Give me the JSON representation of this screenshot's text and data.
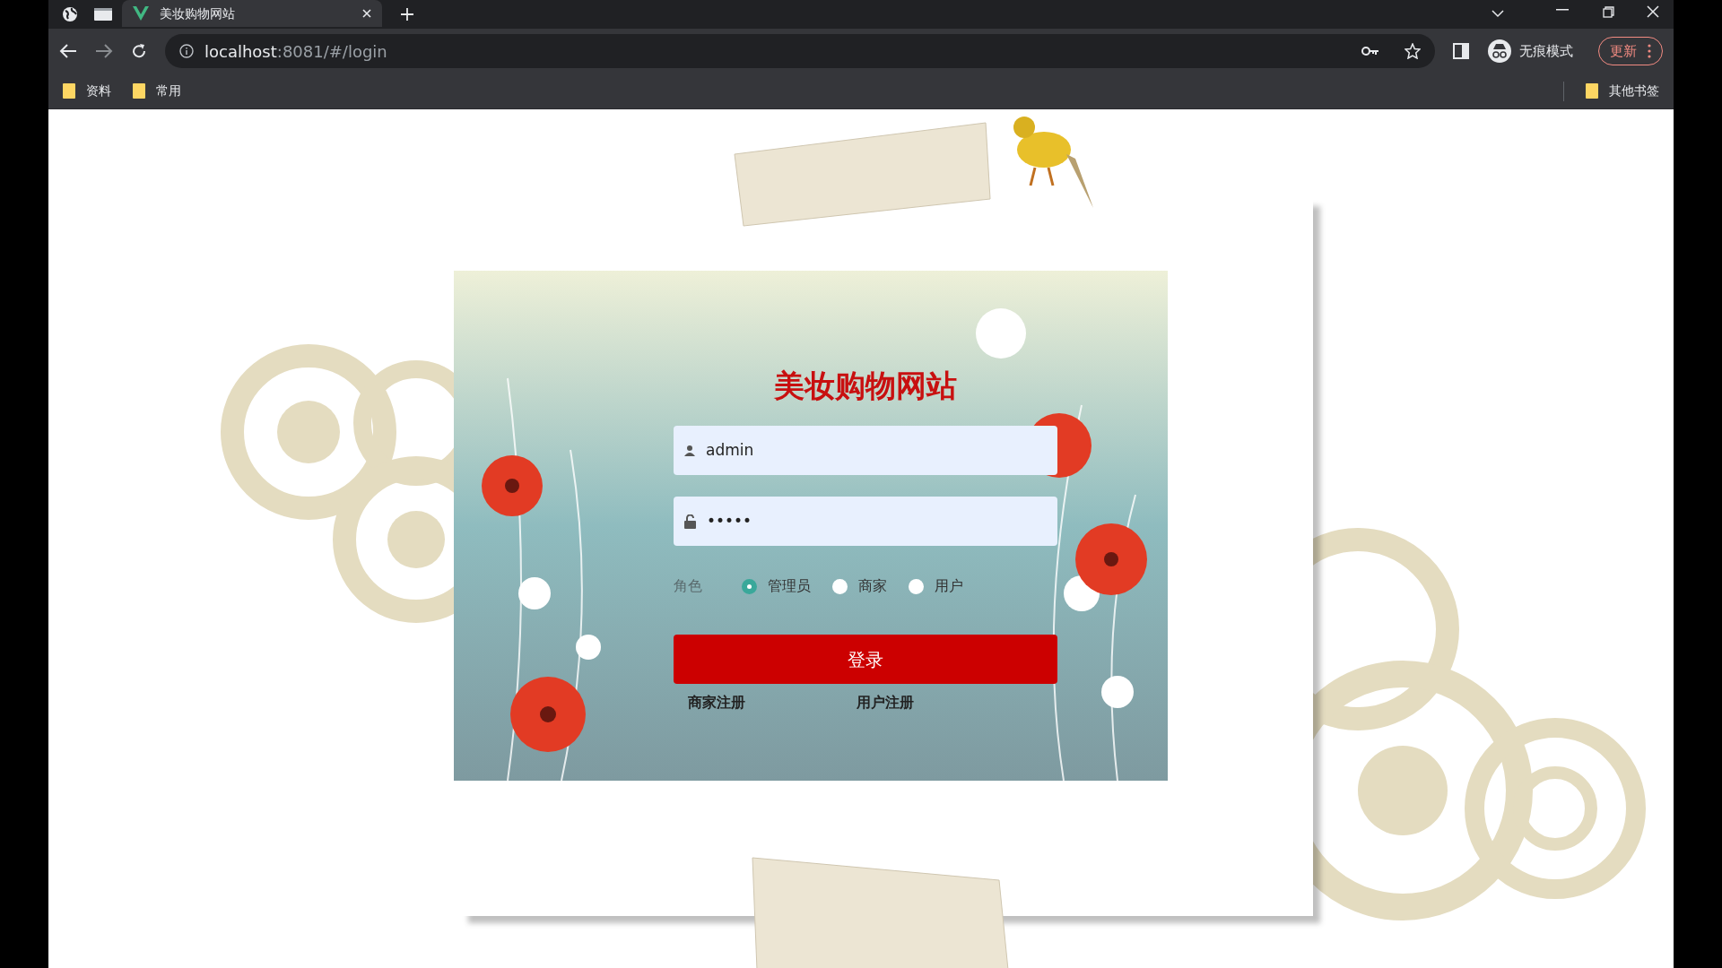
{
  "browser": {
    "tabs": [
      {
        "title": "美妆购物网站",
        "selected": true
      }
    ],
    "url_host": "localhost",
    "url_rest": ":8081/#/login",
    "profile_label": "无痕模式",
    "update_button": "更新",
    "bookmarks": [
      "资料",
      "常用"
    ],
    "other_bookmarks": "其他书签"
  },
  "login": {
    "title": "美妆购物网站",
    "username": {
      "value": "admin"
    },
    "password": {
      "value": "•••••"
    },
    "role_label": "角色",
    "roles": [
      {
        "label": "管理员",
        "selected": true
      },
      {
        "label": "商家",
        "selected": false
      },
      {
        "label": "用户",
        "selected": false
      }
    ],
    "submit": "登录",
    "links": [
      "商家注册",
      "用户注册"
    ]
  }
}
